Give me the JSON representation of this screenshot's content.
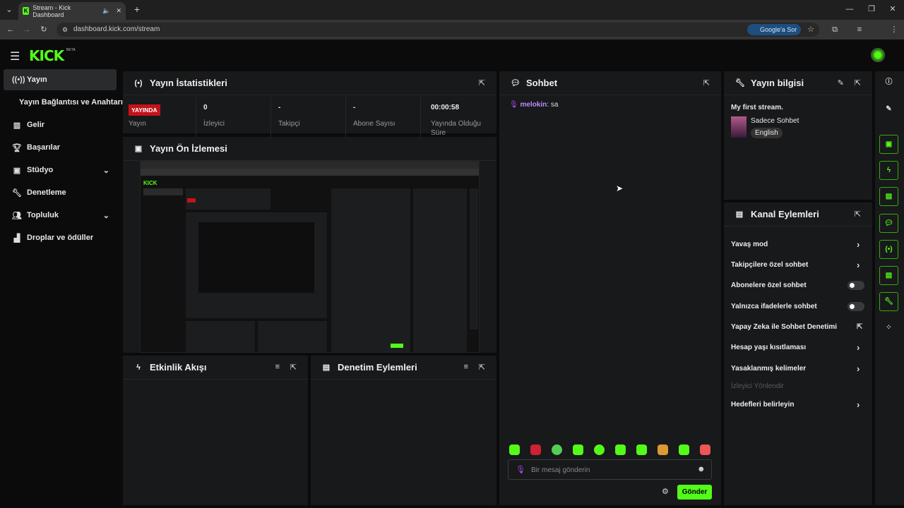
{
  "browser": {
    "tab_title": "Stream - Kick Dashboard",
    "url": "dashboard.kick.com/stream",
    "google_chip": "Google'a Sor"
  },
  "app": {
    "logo": "KICK",
    "logo_badge": "BETA"
  },
  "sidebar": {
    "items": [
      {
        "label": "Yayın",
        "icon": "broadcast-icon",
        "active": true
      },
      {
        "label": "Yayın Bağlantısı ve Anahtarı",
        "icon": "",
        "active": false
      },
      {
        "label": "Gelir",
        "icon": "revenue-icon",
        "active": false
      },
      {
        "label": "Başarılar",
        "icon": "trophy-icon",
        "active": false
      },
      {
        "label": "Stüdyo",
        "icon": "studio-icon",
        "active": false,
        "expandable": true
      },
      {
        "label": "Denetleme",
        "icon": "wrench-icon",
        "active": false
      },
      {
        "label": "Topluluk",
        "icon": "community-icon",
        "active": false,
        "expandable": true
      },
      {
        "label": "Droplar ve ödüller",
        "icon": "drops-icon",
        "active": false
      }
    ]
  },
  "stats_panel": {
    "title": "Yayın İstatistikleri",
    "live_badge": "YAYINDA",
    "stats": [
      {
        "value": "",
        "label": "Yayın"
      },
      {
        "value": "0",
        "label": "İzleyici"
      },
      {
        "value": "-",
        "label": "Takipçi"
      },
      {
        "value": "-",
        "label": "Abone Sayısı"
      },
      {
        "value": "00:00:58",
        "label": "Yayında Olduğu Süre"
      }
    ]
  },
  "preview_panel": {
    "title": "Yayın Ön İzlemesi"
  },
  "activity_panel": {
    "title": "Etkinlik Akışı"
  },
  "moderation_panel": {
    "title": "Denetim Eylemleri"
  },
  "chat": {
    "title": "Sohbet",
    "messages": [
      {
        "user": "melokin",
        "text": ": sa"
      }
    ],
    "input_placeholder": "Bir mesaj gönderin",
    "send_label": "Gönder"
  },
  "stream_info": {
    "title": "Yayın bilgisi",
    "stream_title": "My first stream.",
    "category": "Sadece Sohbet",
    "language": "English"
  },
  "channel_actions": {
    "title": "Kanal Eylemleri",
    "items": [
      {
        "label": "Yavaş mod",
        "control": "arrow"
      },
      {
        "label": "Takipçilere özel sohbet",
        "control": "arrow"
      },
      {
        "label": "Abonelere özel sohbet",
        "control": "toggle"
      },
      {
        "label": "Yalnızca ifadelerle sohbet",
        "control": "toggle"
      },
      {
        "label": "Yapay Zeka ile Sohbet Denetimi",
        "control": "external"
      },
      {
        "label": "Hesap yaşı kısıtlaması",
        "control": "arrow"
      },
      {
        "label": "Yasaklanmış kelimeler",
        "control": "arrow"
      },
      {
        "label": "İzleyici Yönlendir",
        "control": "disabled"
      },
      {
        "label": "Hedefleri belirleyin",
        "control": "arrow"
      }
    ]
  },
  "colors": {
    "accent": "#53fc18",
    "live": "#c4121a",
    "panel": "#18191a",
    "bg": "#0b0b0c"
  }
}
